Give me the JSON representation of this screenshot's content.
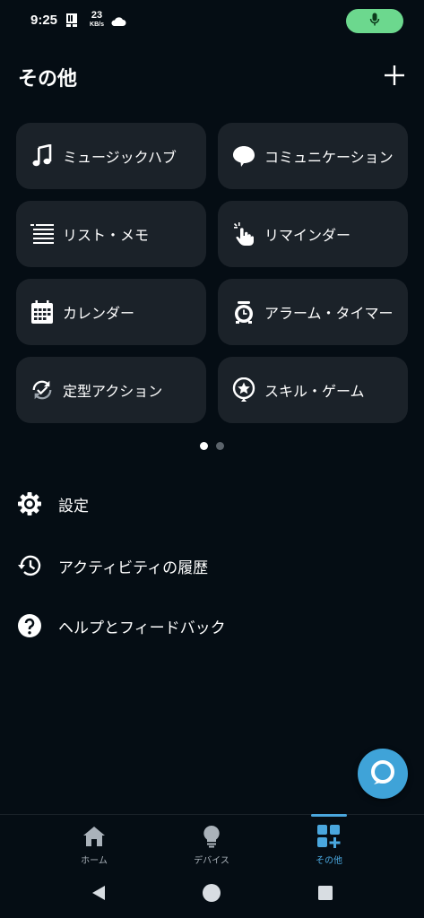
{
  "status_bar": {
    "time": "9:25",
    "net_speed_value": "23",
    "net_speed_unit": "KB/s"
  },
  "header": {
    "title": "その他"
  },
  "tiles": [
    {
      "label": "ミュージックハブ",
      "icon": "music-note-icon"
    },
    {
      "label": "コミュニケーション",
      "icon": "speech-bubble-icon"
    },
    {
      "label": "リスト・メモ",
      "icon": "list-icon"
    },
    {
      "label": "リマインダー",
      "icon": "reminder-hand-icon"
    },
    {
      "label": "カレンダー",
      "icon": "calendar-icon"
    },
    {
      "label": "アラーム・タイマー",
      "icon": "alarm-clock-icon"
    },
    {
      "label": "定型アクション",
      "icon": "routine-check-icon"
    },
    {
      "label": "スキル・ゲーム",
      "icon": "skill-star-icon"
    }
  ],
  "pager": {
    "pages": 2,
    "active": 0
  },
  "list": [
    {
      "label": "設定",
      "icon": "gear-icon"
    },
    {
      "label": "アクティビティの履歴",
      "icon": "history-icon"
    },
    {
      "label": "ヘルプとフィードバック",
      "icon": "help-icon"
    }
  ],
  "bottom_nav": [
    {
      "label": "ホーム",
      "icon": "home-icon"
    },
    {
      "label": "デバイス",
      "icon": "lightbulb-icon"
    },
    {
      "label": "その他",
      "icon": "more-grid-icon",
      "active": true
    }
  ],
  "colors": {
    "background": "#050d14",
    "tile": "#1b2229",
    "accent": "#4aa7de",
    "mic": "#6cd88e",
    "alexa": "#3fa3d8"
  }
}
